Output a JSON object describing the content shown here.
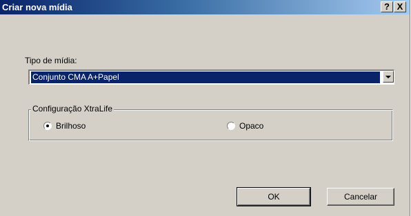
{
  "window": {
    "title": "Criar nova mídia",
    "help_label": "?",
    "close_label": "X"
  },
  "media_type": {
    "label": "Tipo de mídia:",
    "selected": "Conjunto CMA A+Papel"
  },
  "xtralife": {
    "legend": "Configuração XtraLife",
    "options": [
      {
        "label": "Brilhoso",
        "checked": true
      },
      {
        "label": "Opaco",
        "checked": false
      }
    ]
  },
  "buttons": {
    "ok": "OK",
    "cancel": "Cancelar"
  },
  "colors": {
    "dialog_bg": "#d4d0c8",
    "title_gradient_start": "#0a246a",
    "title_gradient_end": "#a6caf0",
    "selection": "#0a246a"
  }
}
